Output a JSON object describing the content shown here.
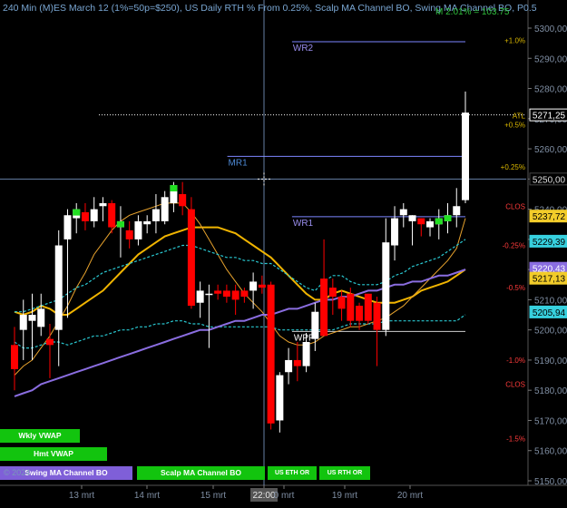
{
  "chart_title": "240 Min (M)ES March 12 (1%=50p=$250), US Daily RTH % From 0.25%, Scalp MA Channel BO, Swing MA Channel BO, P0.5",
  "title_right": "M 2.01% = 103.75",
  "copyright": "© 2024",
  "colors": {
    "background": "#000000",
    "up_candle": "#ffffff",
    "down_candle": "#ff0000",
    "vwap_weekly": "#f0b400",
    "ema_fast": "#e7a22d",
    "ma_channel": "#29c7d0",
    "trend_line": "#8a6de0",
    "pivot_lines": "#7d86ff",
    "crosshair": "#88aadd"
  },
  "chart_data": {
    "type": "candlestick",
    "y_axis_ticks": [
      "5300,00",
      "5290,00",
      "5280,00",
      "5270,00",
      "5260,00",
      "5250,00",
      "5240,00",
      "5230,00",
      "5220,00",
      "5210,00",
      "5200,00",
      "5190,00",
      "5180,00",
      "5170,00",
      "5160,00",
      "5150,00"
    ],
    "x_axis_ticks": [
      "13 mrt",
      "14 mrt",
      "15 mrt",
      "22:00",
      "0 mrt",
      "19 mrt",
      "20 mrt"
    ],
    "ylim": [
      5148,
      5303
    ],
    "candles": [
      {
        "o": 5195,
        "h": 5201,
        "l": 5180,
        "c": 5187
      },
      {
        "o": 5200,
        "h": 5210,
        "l": 5190,
        "c": 5205
      },
      {
        "o": 5203,
        "h": 5212,
        "l": 5190,
        "c": 5205
      },
      {
        "o": 5201,
        "h": 5212,
        "l": 5198,
        "c": 5207
      },
      {
        "o": 5197,
        "h": 5202,
        "l": 5184,
        "c": 5195
      },
      {
        "o": 5200,
        "h": 5233,
        "l": 5188,
        "c": 5228
      },
      {
        "o": 5230,
        "h": 5240,
        "l": 5204,
        "c": 5238
      },
      {
        "o": 5237,
        "h": 5242,
        "l": 5232,
        "c": 5240
      },
      {
        "o": 5239,
        "h": 5242,
        "l": 5233,
        "c": 5236
      },
      {
        "o": 5236,
        "h": 5244,
        "l": 5234,
        "c": 5240
      },
      {
        "o": 5241,
        "h": 5244,
        "l": 5236,
        "c": 5242
      },
      {
        "o": 5242,
        "h": 5243,
        "l": 5232,
        "c": 5234
      },
      {
        "o": 5234,
        "h": 5241,
        "l": 5224,
        "c": 5236
      },
      {
        "o": 5233,
        "h": 5236,
        "l": 5227,
        "c": 5230
      },
      {
        "o": 5230,
        "h": 5238,
        "l": 5228,
        "c": 5236
      },
      {
        "o": 5235,
        "h": 5238,
        "l": 5232,
        "c": 5236
      },
      {
        "o": 5236,
        "h": 5245,
        "l": 5232,
        "c": 5240
      },
      {
        "o": 5236,
        "h": 5246,
        "l": 5235,
        "c": 5244
      },
      {
        "o": 5242,
        "h": 5249,
        "l": 5239,
        "c": 5248
      },
      {
        "o": 5245,
        "h": 5249,
        "l": 5238,
        "c": 5241
      },
      {
        "o": 5240,
        "h": 5244,
        "l": 5207,
        "c": 5208
      },
      {
        "o": 5209,
        "h": 5216,
        "l": 5204,
        "c": 5213
      },
      {
        "o": 5212,
        "h": 5215,
        "l": 5194,
        "c": 5212
      },
      {
        "o": 5213,
        "h": 5215,
        "l": 5210,
        "c": 5212
      },
      {
        "o": 5213,
        "h": 5215,
        "l": 5209,
        "c": 5211
      },
      {
        "o": 5213,
        "h": 5215,
        "l": 5205,
        "c": 5210
      },
      {
        "o": 5213,
        "h": 5214,
        "l": 5209,
        "c": 5211
      },
      {
        "o": 5213,
        "h": 5219,
        "l": 5207,
        "c": 5216
      },
      {
        "o": 5215,
        "h": 5218,
        "l": 5212,
        "c": 5214
      },
      {
        "o": 5215,
        "h": 5216,
        "l": 5167,
        "c": 5169
      },
      {
        "o": 5170,
        "h": 5186,
        "l": 5166,
        "c": 5185
      },
      {
        "o": 5186,
        "h": 5194,
        "l": 5182,
        "c": 5190
      },
      {
        "o": 5190,
        "h": 5196,
        "l": 5183,
        "c": 5188
      },
      {
        "o": 5188,
        "h": 5199,
        "l": 5186,
        "c": 5196
      },
      {
        "o": 5197,
        "h": 5209,
        "l": 5193,
        "c": 5206
      },
      {
        "o": 5217,
        "h": 5230,
        "l": 5203,
        "c": 5198
      },
      {
        "o": 5214,
        "h": 5217,
        "l": 5205,
        "c": 5211
      },
      {
        "o": 5211,
        "h": 5213,
        "l": 5203,
        "c": 5207
      },
      {
        "o": 5212,
        "h": 5214,
        "l": 5201,
        "c": 5203
      },
      {
        "o": 5208,
        "h": 5209,
        "l": 5200,
        "c": 5203
      },
      {
        "o": 5212,
        "h": 5212,
        "l": 5202,
        "c": 5203
      },
      {
        "o": 5209,
        "h": 5211,
        "l": 5188,
        "c": 5200
      },
      {
        "o": 5200,
        "h": 5237,
        "l": 5198,
        "c": 5229
      },
      {
        "o": 5228,
        "h": 5241,
        "l": 5223,
        "c": 5237
      },
      {
        "o": 5238,
        "h": 5242,
        "l": 5234,
        "c": 5240
      },
      {
        "o": 5236,
        "h": 5238,
        "l": 5228,
        "c": 5238
      },
      {
        "o": 5237,
        "h": 5237,
        "l": 5231,
        "c": 5235
      },
      {
        "o": 5234,
        "h": 5237,
        "l": 5231,
        "c": 5236
      },
      {
        "o": 5235,
        "h": 5240,
        "l": 5230,
        "c": 5237
      },
      {
        "o": 5236,
        "h": 5242,
        "l": 5232,
        "c": 5238
      },
      {
        "o": 5238,
        "h": 5247,
        "l": 5234,
        "c": 5241
      },
      {
        "o": 5243,
        "h": 5279,
        "l": 5242,
        "c": 5272
      }
    ],
    "green_signal_candles": [
      7,
      12,
      18,
      48,
      49
    ],
    "series": [
      {
        "name": "weekly-vwap",
        "values": [
          5206,
          5205,
          5206,
          5208,
          5207,
          5205,
          5205,
          5207,
          5209,
          5211,
          5213,
          5216,
          5219,
          5222,
          5225,
          5227,
          5229,
          5231,
          5232,
          5233,
          5234,
          5234,
          5234,
          5234,
          5233,
          5232,
          5230,
          5228,
          5226,
          5224,
          5221,
          5218,
          5215,
          5212,
          5210,
          5210,
          5212,
          5213,
          5212,
          5211,
          5210,
          5209,
          5209,
          5209,
          5210,
          5211,
          5213,
          5214,
          5215,
          5216,
          5218,
          5220
        ]
      },
      {
        "name": "fast-ema",
        "values": [
          5185,
          5188,
          5190,
          5194,
          5198,
          5203,
          5208,
          5214,
          5219,
          5225,
          5229,
          5233,
          5236,
          5238,
          5239,
          5240,
          5241,
          5242,
          5242,
          5242,
          5239,
          5235,
          5230,
          5225,
          5220,
          5216,
          5212,
          5209,
          5206,
          5202,
          5198,
          5196,
          5195,
          5195,
          5196,
          5198,
          5199,
          5200,
          5201,
          5201,
          5202,
          5203,
          5204,
          5206,
          5208,
          5211,
          5214,
          5217,
          5220,
          5223,
          5227,
          5237
        ]
      },
      {
        "name": "channel-upper",
        "values": [
          5206,
          5206,
          5207,
          5208,
          5209,
          5210,
          5212,
          5214,
          5215,
          5217,
          5219,
          5220,
          5221,
          5222,
          5223,
          5224,
          5225,
          5226,
          5227,
          5228,
          5228,
          5227,
          5226,
          5225,
          5224,
          5224,
          5223,
          5223,
          5222,
          5222,
          5220,
          5218,
          5216,
          5214,
          5213,
          5216,
          5218,
          5218,
          5216,
          5215,
          5215,
          5215,
          5216,
          5218,
          5219,
          5221,
          5222,
          5223,
          5224,
          5226,
          5228,
          5230
        ]
      },
      {
        "name": "channel-lower",
        "values": [
          5196,
          5194,
          5194,
          5195,
          5196,
          5196,
          5195,
          5196,
          5197,
          5198,
          5198,
          5199,
          5200,
          5200,
          5201,
          5201,
          5202,
          5202,
          5203,
          5203,
          5202,
          5202,
          5201,
          5201,
          5201,
          5201,
          5201,
          5201,
          5201,
          5201,
          5200,
          5200,
          5200,
          5200,
          5200,
          5200,
          5200,
          5201,
          5202,
          5202,
          5202,
          5202,
          5203,
          5203,
          5203,
          5203,
          5203,
          5203,
          5203,
          5203,
          5203,
          5205
        ]
      },
      {
        "name": "trend-line",
        "values": [
          5178,
          5179,
          5180,
          5182,
          5183,
          5184,
          5185,
          5186,
          5187,
          5188,
          5189,
          5190,
          5191,
          5192,
          5193,
          5194,
          5195,
          5196,
          5197,
          5198,
          5199,
          5200,
          5200,
          5201,
          5202,
          5203,
          5203,
          5204,
          5205,
          5205,
          5206,
          5207,
          5207,
          5208,
          5209,
          5210,
          5210,
          5211,
          5211,
          5212,
          5213,
          5213,
          5214,
          5215,
          5215,
          5216,
          5216,
          5217,
          5218,
          5218,
          5219,
          5220
        ]
      }
    ],
    "horizontal_levels": [
      {
        "name": "WR2",
        "value": 5295.5,
        "label": "WR2",
        "from": 0.555
      },
      {
        "name": "MR1",
        "value": 5257.5,
        "label": "MR1",
        "from": 0.432
      },
      {
        "name": "WR1",
        "value": 5237.5,
        "label": "WR1",
        "from": 0.555
      },
      {
        "name": "WPP",
        "value": 5199.5,
        "label": "WPP",
        "from": 0.555
      },
      {
        "name": "last-price",
        "value": 5271.25,
        "label": "",
        "from": 0.188
      }
    ],
    "percent_labels": [
      {
        "text": "+1.0%",
        "value": 5296,
        "color": "#d9b600"
      },
      {
        "text": "+0.5%",
        "value": 5268,
        "color": "#d9b600"
      },
      {
        "text": "+0.25%",
        "value": 5254,
        "color": "#d9b600"
      },
      {
        "text": "CLOS",
        "value": 5241,
        "color": "#ff3b3b"
      },
      {
        "text": "-0.25%",
        "value": 5228,
        "color": "#ff3b3b"
      },
      {
        "text": "-0.5%",
        "value": 5214,
        "color": "#ff3b3b"
      },
      {
        "text": "-1.0%",
        "value": 5190,
        "color": "#ff3b3b"
      },
      {
        "text": "CLOS",
        "value": 5182,
        "color": "#ff3b3b"
      },
      {
        "text": "-1.5%",
        "value": 5164,
        "color": "#ff3b3b"
      },
      {
        "text": "ATL",
        "value": 5271,
        "color": "#d9b600"
      }
    ],
    "price_tags": [
      {
        "text": "5271,25",
        "value": 5271.25,
        "bg": "#000000",
        "fg": "#ffffff",
        "border": "#ffffff"
      },
      {
        "text": "5250,00",
        "value": 5250,
        "bg": "#000000",
        "fg": "#dddddd",
        "border": "#444444"
      },
      {
        "text": "5237,72",
        "value": 5237.72,
        "bg": "#f2cc2a",
        "fg": "#000000",
        "border": "#f2cc2a"
      },
      {
        "text": "5229,39",
        "value": 5229.39,
        "bg": "#37d0de",
        "fg": "#000000",
        "border": "#37d0de"
      },
      {
        "text": "5220,43",
        "value": 5220.43,
        "bg": "#8a6de0",
        "fg": "#ffffff",
        "border": "#8a6de0"
      },
      {
        "text": "5217,13",
        "value": 5217.13,
        "bg": "#f2cc2a",
        "fg": "#000000",
        "border": "#f2cc2a"
      },
      {
        "text": "5205,94",
        "value": 5205.94,
        "bg": "#37d0de",
        "fg": "#000000",
        "border": "#37d0de"
      }
    ],
    "crosshair": {
      "x_label": "22:00",
      "y_value": 5250
    }
  },
  "study_buttons": [
    {
      "label": "Wkly VWAP"
    },
    {
      "label": "Hmt VWAP"
    },
    {
      "label": "Swing MA Channel BO"
    },
    {
      "label": "Scalp MA Channel BO"
    },
    {
      "label": "US ETH OR"
    },
    {
      "label": "US RTH OR"
    }
  ]
}
